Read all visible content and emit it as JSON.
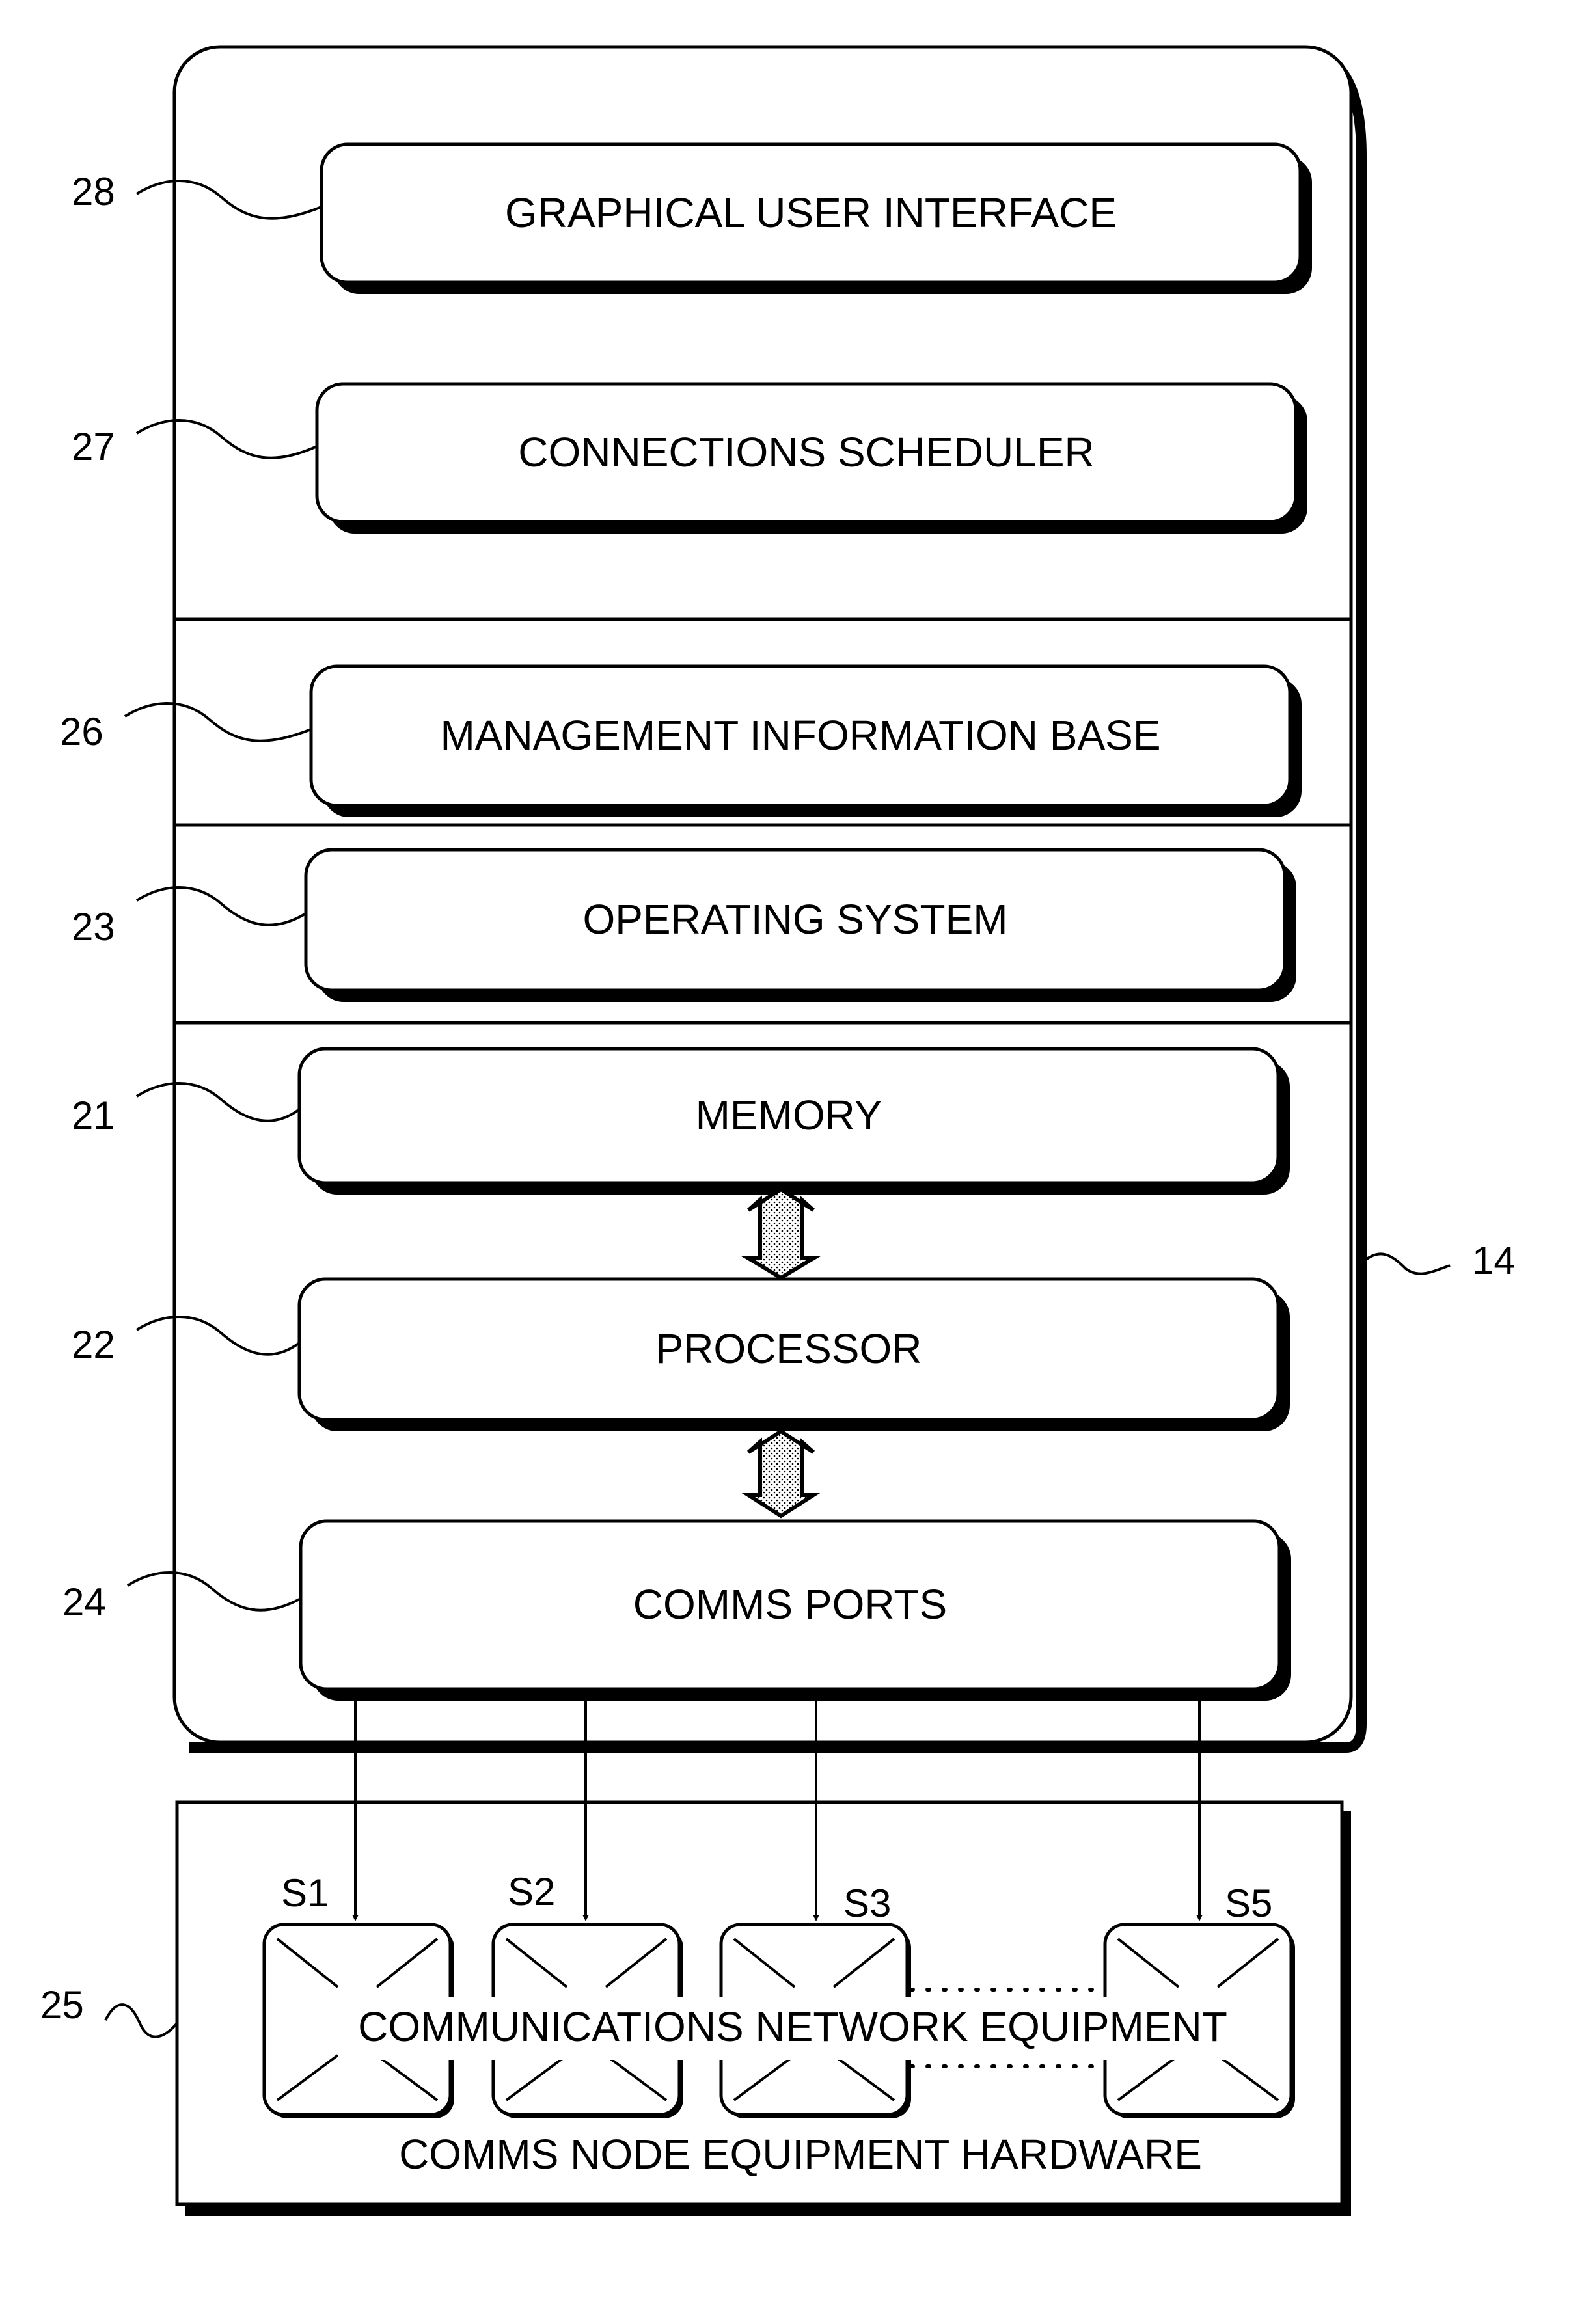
{
  "figure": {
    "system_box": {
      "ref": "14"
    },
    "layers": [
      {
        "id": "gui",
        "ref": "28",
        "label": "GRAPHICAL USER INTERFACE"
      },
      {
        "id": "scheduler",
        "ref": "27",
        "label": "CONNECTIONS SCHEDULER"
      },
      {
        "id": "mib",
        "ref": "26",
        "label": "MANAGEMENT INFORMATION BASE"
      },
      {
        "id": "os",
        "ref": "23",
        "label": "OPERATING SYSTEM"
      },
      {
        "id": "memory",
        "ref": "21",
        "label": "MEMORY"
      },
      {
        "id": "processor",
        "ref": "22",
        "label": "PROCESSOR"
      },
      {
        "id": "comms-ports",
        "ref": "24",
        "label": "COMMS PORTS"
      }
    ],
    "hardware": {
      "ref": "25",
      "network_label": "COMMUNICATIONS NETWORK EQUIPMENT",
      "caption": "COMMS NODE EQUIPMENT HARDWARE",
      "switches": [
        {
          "name": "S1"
        },
        {
          "name": "S2"
        },
        {
          "name": "S3"
        },
        {
          "name": "S5"
        }
      ]
    },
    "colors": {
      "ink": "#000000",
      "paper": "#ffffff",
      "arrow_fill": "#d9d9d9"
    }
  }
}
